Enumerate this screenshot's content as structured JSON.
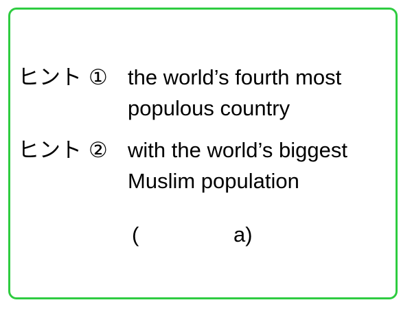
{
  "border_color": "#2ecc40",
  "hints": [
    {
      "label": "ヒント",
      "number": "①",
      "lines": [
        "the world’s fourth most",
        "populous country"
      ]
    },
    {
      "label": "ヒント",
      "number": "②",
      "lines": [
        "with the world’s biggest",
        "Muslim population"
      ]
    }
  ],
  "answer": {
    "open_paren": "(",
    "blank_with_close": "a)"
  }
}
